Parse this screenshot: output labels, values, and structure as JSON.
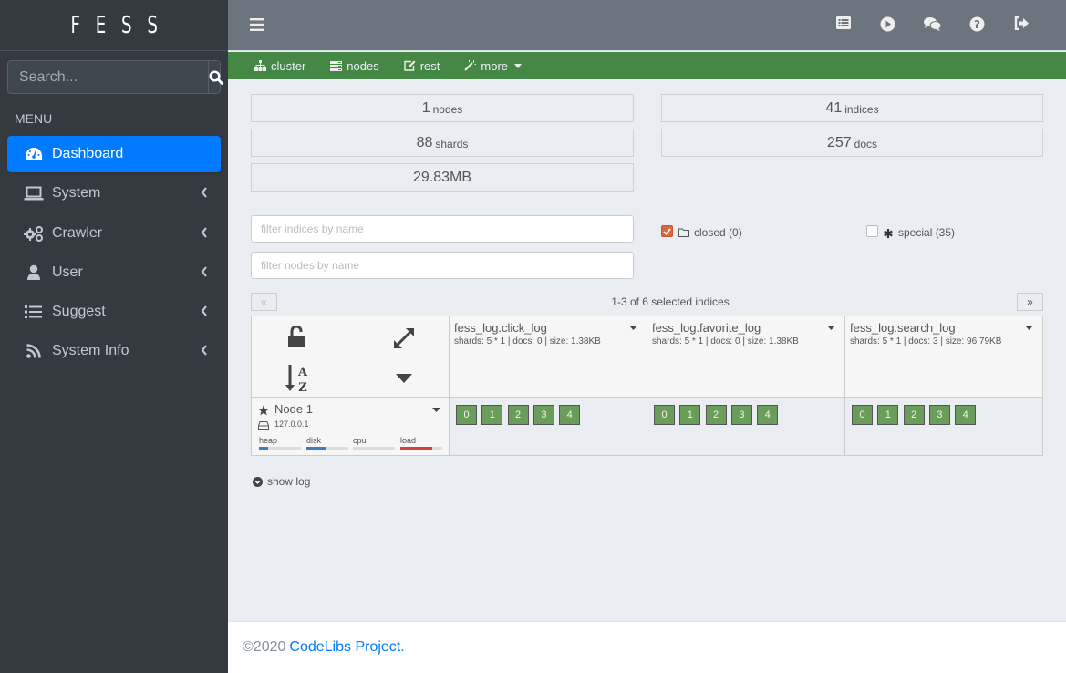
{
  "brand": "FESS",
  "sidebar": {
    "search_placeholder": "Search...",
    "menu_header": "MENU",
    "items": [
      {
        "label": "Dashboard",
        "icon": "tachometer-icon",
        "active": true
      },
      {
        "label": "System",
        "icon": "laptop-icon"
      },
      {
        "label": "Crawler",
        "icon": "cogs-icon"
      },
      {
        "label": "User",
        "icon": "user-icon"
      },
      {
        "label": "Suggest",
        "icon": "list-icon"
      },
      {
        "label": "System Info",
        "icon": "rss-icon"
      }
    ]
  },
  "topbar": {
    "icons": [
      "list-alt-icon",
      "play-circle-icon",
      "comments-icon",
      "question-circle-icon",
      "sign-out-icon"
    ]
  },
  "greennav": {
    "items": [
      {
        "label": "cluster",
        "icon": "sitemap-icon"
      },
      {
        "label": "nodes",
        "icon": "tasks-icon"
      },
      {
        "label": "rest",
        "icon": "edit-icon"
      },
      {
        "label": "more",
        "icon": "magic-icon",
        "dropdown": true
      }
    ]
  },
  "stats": {
    "nodes": {
      "value": "1",
      "label": "nodes"
    },
    "indices": {
      "value": "41",
      "label": "indices"
    },
    "shards": {
      "value": "88",
      "label": "shards"
    },
    "docs": {
      "value": "257",
      "label": "docs"
    },
    "size": {
      "value": "29.83MB"
    }
  },
  "filters": {
    "indices_placeholder": "filter indices by name",
    "nodes_placeholder": "filter nodes by name",
    "closed_label": "closed (0)",
    "closed_checked": true,
    "special_label": "special (35)",
    "special_checked": false
  },
  "pager": {
    "prev": "«",
    "next": "»",
    "text": "1-3 of 6 selected indices"
  },
  "indices": [
    {
      "name": "fess_log.click_log",
      "meta": "shards: 5 * 1 | docs: 0 | size: 1.38KB",
      "shards": [
        "0",
        "1",
        "2",
        "3",
        "4"
      ]
    },
    {
      "name": "fess_log.favorite_log",
      "meta": "shards: 5 * 1 | docs: 0 | size: 1.38KB",
      "shards": [
        "0",
        "1",
        "2",
        "3",
        "4"
      ]
    },
    {
      "name": "fess_log.search_log",
      "meta": "shards: 5 * 1 | docs: 3 | size: 96.79KB",
      "shards": [
        "0",
        "1",
        "2",
        "3",
        "4"
      ]
    }
  ],
  "node": {
    "name": "Node 1",
    "address": "127.0.0.1",
    "meters": [
      {
        "label": "heap",
        "percent": 22,
        "color": "#3a7fc0"
      },
      {
        "label": "disk",
        "percent": 45,
        "color": "#3a7fc0"
      },
      {
        "label": "cpu",
        "percent": 0,
        "color": "#3a7fc0"
      },
      {
        "label": "load",
        "percent": 77,
        "color": "#d04040"
      }
    ]
  },
  "show_log": "show log",
  "footer": {
    "copyright": "©2020",
    "link": "CodeLibs Project."
  }
}
